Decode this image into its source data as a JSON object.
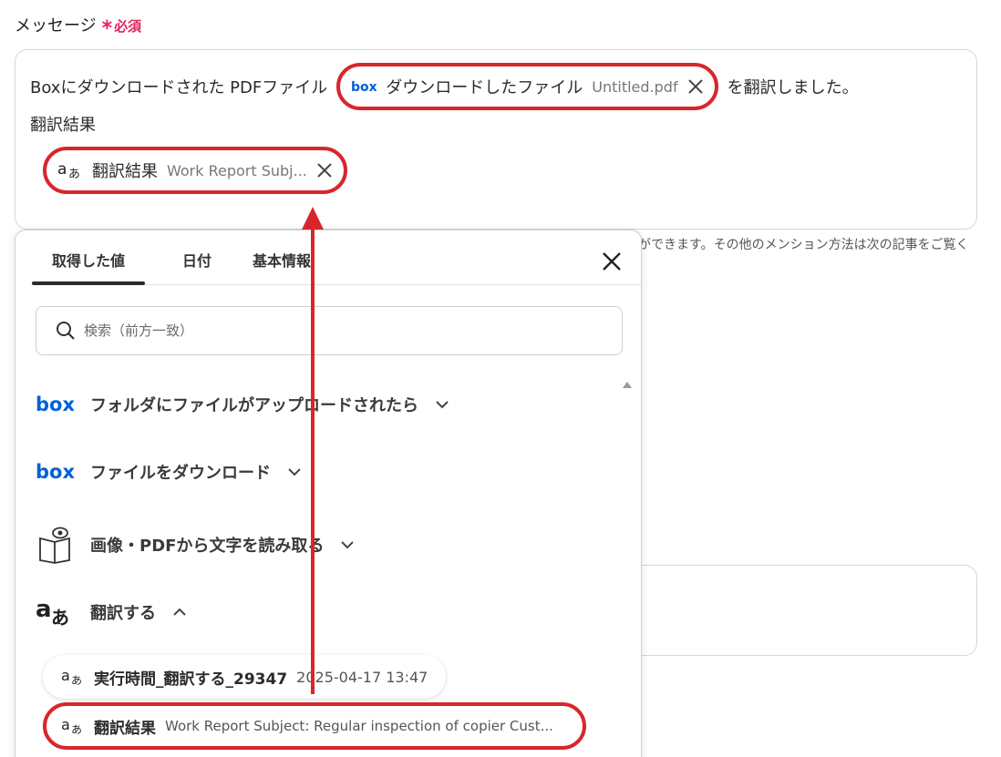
{
  "field": {
    "label": "メッセージ",
    "required_mark": "*",
    "required_text": "必須"
  },
  "message": {
    "text_before": "Boxにダウンロードされた PDFファイル",
    "pill1": {
      "icon": "box-logo-icon",
      "logo_text": "box",
      "label": "ダウンロードしたファイル",
      "value": "Untitled.pdf"
    },
    "text_after": "を翻訳しました。",
    "line2": "翻訳結果",
    "pill2": {
      "icon": "translate-icon",
      "label": "翻訳結果",
      "value": "Work Report Subj..."
    }
  },
  "helper_text": "ができます。その他のメンション方法は次の記事をご覧く",
  "dropdown": {
    "tabs": [
      "取得した値",
      "日付",
      "基本情報"
    ],
    "active_tab": 0,
    "search_placeholder": "検索（前方一致）",
    "sections": [
      {
        "icon": "box-logo-icon",
        "logo_text": "box",
        "label": "フォルダにファイルがアップロードされたら",
        "expanded": false
      },
      {
        "icon": "box-logo-icon",
        "logo_text": "box",
        "label": "ファイルをダウンロード",
        "expanded": false
      },
      {
        "icon": "ocr-book-icon",
        "label": "画像・PDFから文字を読み取る",
        "expanded": false
      },
      {
        "icon": "translate-icon",
        "label": "翻訳する",
        "expanded": true
      }
    ],
    "items": [
      {
        "icon": "translate-icon",
        "label": "実行時間_翻訳する_29347",
        "value": "2025-04-17 13:47"
      },
      {
        "icon": "translate-icon",
        "label": "翻訳結果",
        "value": "Work Report Subject: Regular inspection of copier Cust..."
      }
    ]
  },
  "colors": {
    "highlight": "#d9262c",
    "box_blue": "#0061d5",
    "required": "#e0245e"
  }
}
